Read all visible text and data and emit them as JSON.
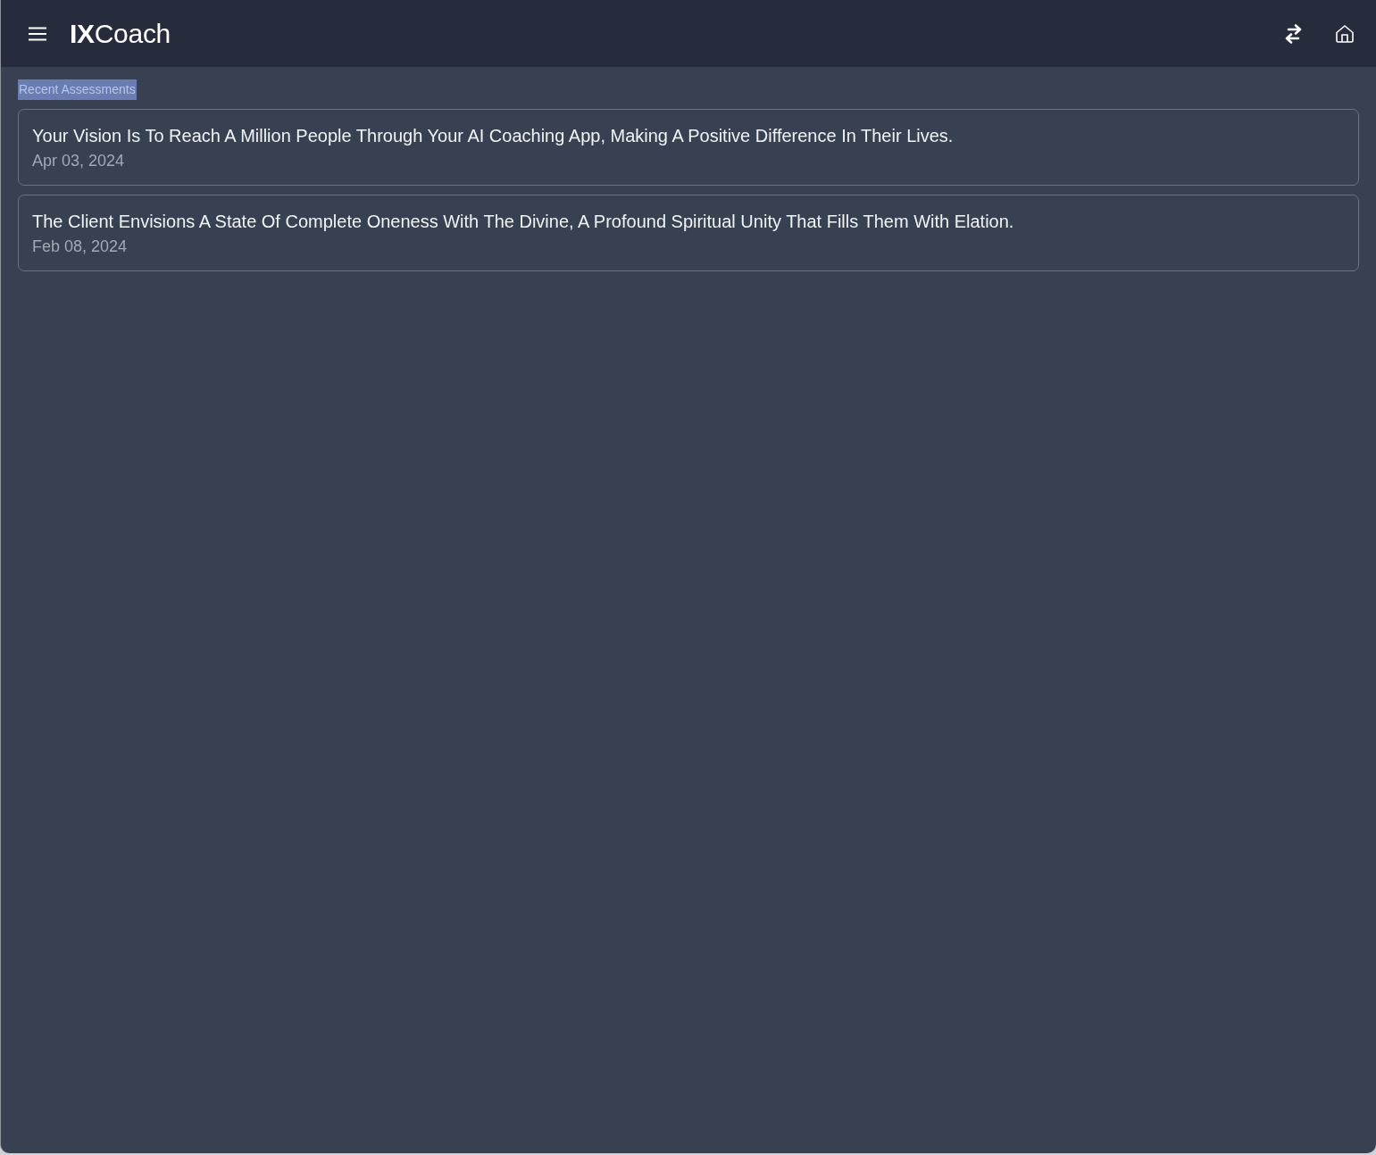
{
  "app_bar": {
    "logo": "**IX**Coach"
  },
  "section": {
    "title": "Recent Assessments",
    "highlighted": true
  },
  "assessments": [
    {
      "title": "Your Vision Is To Reach A Million People Through Your AI Coaching App, Making A Positive Difference In Their Lives.",
      "date": "Apr 03, 2024"
    },
    {
      "title": "The Client Envisions A State Of Complete Oneness With The Divine, A Profound Spiritual Unity That Fills Them With Elation.",
      "date": "Feb 08, 2024"
    }
  ]
}
